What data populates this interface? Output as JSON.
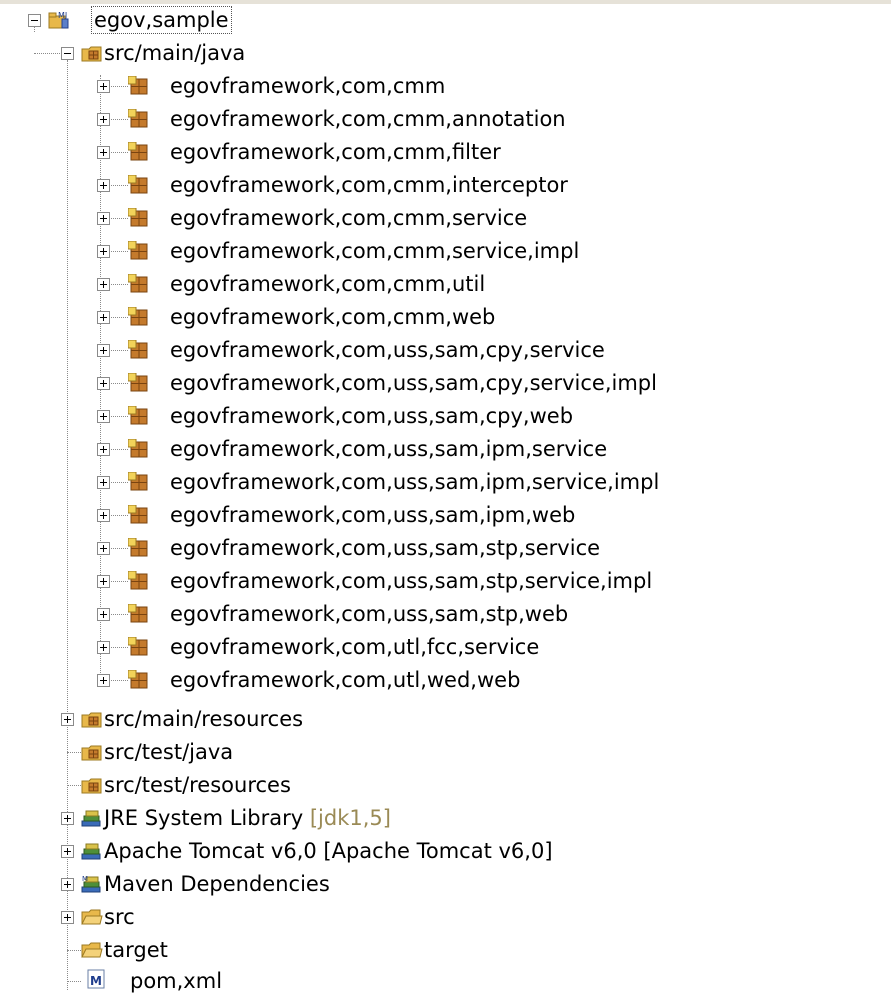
{
  "tree": {
    "root": {
      "label": "egov,sample"
    },
    "src_main_java": {
      "label": "src/main/java"
    },
    "packages": [
      "egovframework,com,cmm",
      "egovframework,com,cmm,annotation",
      "egovframework,com,cmm,filter",
      "egovframework,com,cmm,interceptor",
      "egovframework,com,cmm,service",
      "egovframework,com,cmm,service,impl",
      "egovframework,com,cmm,util",
      "egovframework,com,cmm,web",
      "egovframework,com,uss,sam,cpy,service",
      "egovframework,com,uss,sam,cpy,service,impl",
      "egovframework,com,uss,sam,cpy,web",
      "egovframework,com,uss,sam,ipm,service",
      "egovframework,com,uss,sam,ipm,service,impl",
      "egovframework,com,uss,sam,ipm,web",
      "egovframework,com,uss,sam,stp,service",
      "egovframework,com,uss,sam,stp,service,impl",
      "egovframework,com,uss,sam,stp,web",
      "egovframework,com,utl,fcc,service",
      "egovframework,com,utl,wed,web"
    ],
    "src_main_resources": {
      "label": "src/main/resources"
    },
    "src_test_java": {
      "label": "src/test/java"
    },
    "src_test_resources": {
      "label": "src/test/resources"
    },
    "jre": {
      "label": "JRE System Library",
      "decoration": "[jdk1,5]"
    },
    "tomcat": {
      "label": "Apache Tomcat v6,0 [Apache Tomcat v6,0]"
    },
    "maven": {
      "label": "Maven Dependencies"
    },
    "src": {
      "label": "src"
    },
    "target": {
      "label": "target"
    },
    "pom": {
      "label": "pom,xml"
    }
  },
  "colors": {
    "folder": "#e8b84a",
    "package_brown": "#b5651d",
    "decoration": "#9a8a55"
  },
  "icons": {
    "project": "maven-java-project-icon",
    "source_folder": "source-folder-icon",
    "package": "package-icon",
    "library": "library-icon",
    "maven_library": "maven-library-icon",
    "folder": "folder-icon",
    "pom": "pom-file-icon"
  }
}
